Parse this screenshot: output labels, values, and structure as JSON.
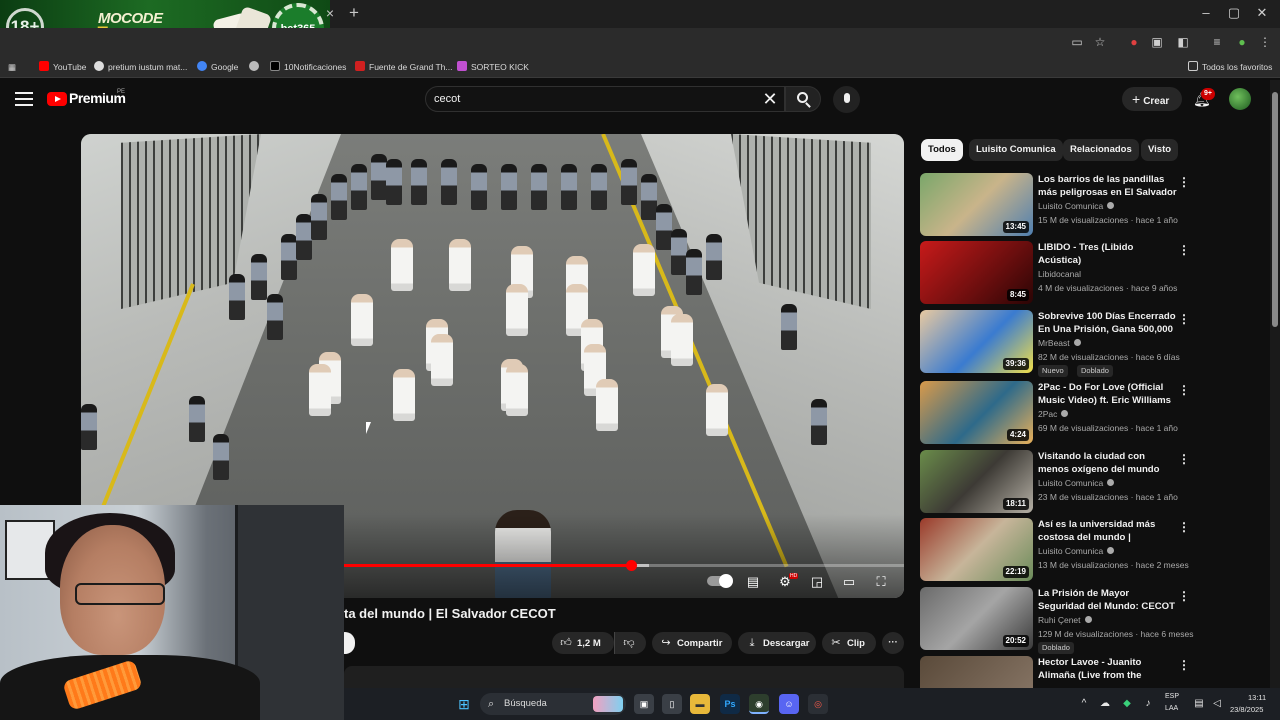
{
  "browser": {
    "tab_banner": {
      "age_badge": "18+",
      "brand": "MOCODE",
      "brand_number": "5",
      "chip_text": "bet365"
    },
    "tab_close": "×",
    "new_tab": "+",
    "window_controls": {
      "minimize": "–",
      "maximize": "▢",
      "close": "✕"
    },
    "toolbar_icons": [
      "cast-icon",
      "star-icon",
      "extension-icon",
      "profile-avatar-icon",
      "menu-kebab-icon"
    ],
    "bookmarks": [
      {
        "label": "YouTube",
        "color": "#ff0000"
      },
      {
        "label": "pretium iustum mat...",
        "color": "#dddddd"
      },
      {
        "label": "Google",
        "color": "#4285f4"
      },
      {
        "label": "",
        "color": "#bbbbbb"
      },
      {
        "label": "10Notificaciones",
        "color": "#000000"
      },
      {
        "label": "Fuente de Grand Th...",
        "color": "#d02020"
      },
      {
        "label": "SORTEO KICK",
        "color": "#c050d0"
      }
    ],
    "all_favorites": "Todos los favoritos"
  },
  "youtube": {
    "logo_text": "Premium",
    "country_code": "PE",
    "search": {
      "value": "cecot",
      "clear": "✕"
    },
    "create_label": "Crear",
    "create_plus": "+",
    "notification_count": "9+",
    "accent_color": "#ff0000"
  },
  "player": {
    "progress_fraction": 0.513,
    "buffer_fraction": 0.545,
    "controls": [
      "autoplay-toggle",
      "subtitles-icon",
      "settings-icon",
      "miniplayer-icon",
      "theater-icon",
      "fullscreen-icon"
    ],
    "settings_badge": "HD",
    "title": "ta del mundo | El Salvador CECOT"
  },
  "actions": {
    "like_count": "1,2 M",
    "share": "Compartir",
    "download": "Descargar",
    "clip": "Clip",
    "more": "···"
  },
  "chips": [
    "Todos",
    "Luisito Comunica",
    "Relacionados",
    "Visto"
  ],
  "recommendations": [
    {
      "title": "Los barrios de las pandillas más peligrosas en El Salvador | ...",
      "channel": "Luisito Comunica",
      "verified": true,
      "meta": "15 M de visualizaciones · hace 1 año",
      "duration": "13:45",
      "tags": []
    },
    {
      "title": "LIBIDO - Tres (Libido Acústica)",
      "channel": "Libidocanal",
      "verified": false,
      "meta": "4 M de visualizaciones · hace 9 años",
      "duration": "8:45",
      "tags": []
    },
    {
      "title": "Sobrevive 100 Días Encerrado En Una Prisión, Gana 500,000 ...",
      "channel": "MrBeast",
      "verified": true,
      "meta": "82 M de visualizaciones · hace 6 días",
      "duration": "39:36",
      "tags": [
        "Nuevo",
        "Doblado"
      ]
    },
    {
      "title": "2Pac - Do For Love (Official Music Video) ft. Eric Williams",
      "channel": "2Pac",
      "verified": true,
      "meta": "69 M de visualizaciones · hace 1 año",
      "duration": "4:24",
      "tags": []
    },
    {
      "title": "Visitando la ciudad con menos oxígeno del mundo (peligrosa ...",
      "channel": "Luisito Comunica",
      "verified": true,
      "meta": "23 M de visualizaciones · hace 1 año",
      "duration": "18:11",
      "tags": []
    },
    {
      "title": "Así es la universidad más costosa del mundo | HARVARD",
      "channel": "Luisito Comunica",
      "verified": true,
      "meta": "13 M de visualizaciones · hace 2 meses",
      "duration": "22:19",
      "tags": []
    },
    {
      "title": "La Prisión de Mayor Seguridad del Mundo: CECOT (Los más ...",
      "channel": "Ruhi Çenet",
      "verified": true,
      "meta": "129 M de visualizaciones · hace 6 meses",
      "duration": "20:52",
      "tags": [
        "Doblado"
      ]
    },
    {
      "title": "Hector Lavoe - Juanito Alimaña (Live from the Palladium NYC)",
      "channel": "",
      "verified": false,
      "meta": "",
      "duration": "",
      "tags": []
    }
  ],
  "taskbar": {
    "search_label": "Búsqueda",
    "lang_line1": "ESP",
    "lang_line2": "LAA",
    "time": "13:11",
    "date": "23/8/2025"
  }
}
